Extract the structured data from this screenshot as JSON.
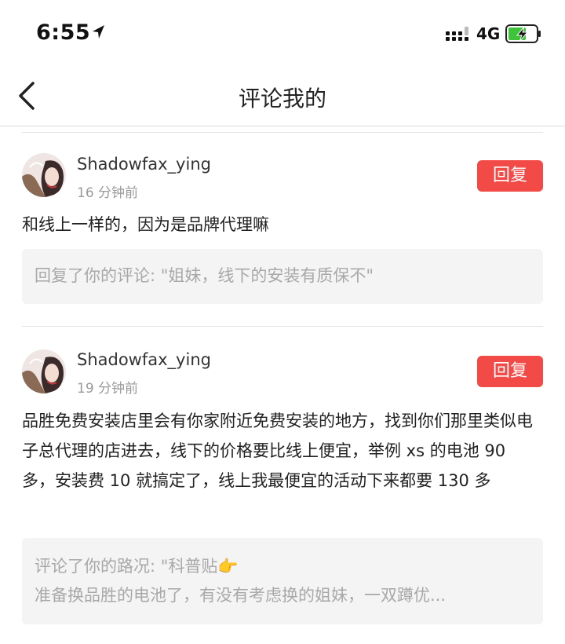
{
  "status_bar": {
    "time": "6:55",
    "network": "4G",
    "icons": [
      "location-arrow-icon",
      "signal-icon",
      "battery-charging-icon"
    ],
    "battery_color": "#3fc33a"
  },
  "nav": {
    "title": "评论我的",
    "back_icon": "chevron-left-icon"
  },
  "colors": {
    "reply_button": "#f24a47",
    "quote_bg": "#f4f4f4",
    "muted_text": "#9a9a9a"
  },
  "comments": [
    {
      "username": "Shadowfax_ying",
      "time_ago": "16 分钟前",
      "reply_label": "回复",
      "text": "和线上一样的，因为是品牌代理嘛",
      "quote": [
        "回复了你的评论: \"姐妹，线下的安装有质保不\""
      ]
    },
    {
      "username": "Shadowfax_ying",
      "time_ago": "19 分钟前",
      "reply_label": "回复",
      "text": "品胜免费安装店里会有你家附近免费安装的地方，找到你们那里类似电子总代理的店进去，线下的价格要比线上便宜，举例 xs 的电池 90 多，安装费 10 就搞定了，线上我最便宜的活动下来都要 130 多",
      "quote": [
        "评论了你的路况: \"科普贴👉",
        "准备换品胜的电池了，有没有考虑换的姐妹，一双蹲优..."
      ]
    }
  ]
}
